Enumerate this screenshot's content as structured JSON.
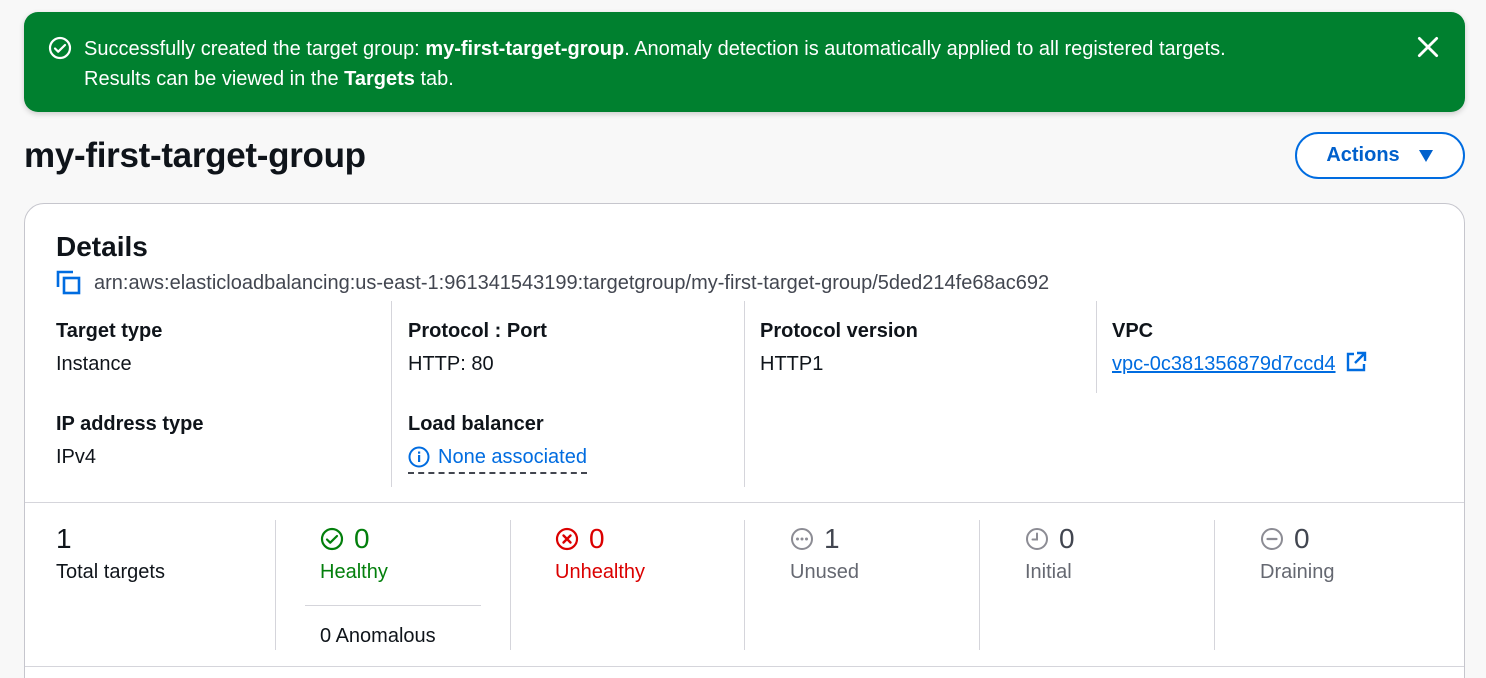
{
  "flash": {
    "line1_prefix": "Successfully created the target group: ",
    "line1_name": "my-first-target-group",
    "line1_suffix": ". Anomaly detection is automatically applied to all registered targets.",
    "line2_prefix": "Results can be viewed in the ",
    "line2_tab": "Targets",
    "line2_suffix": " tab.",
    "bg_color": "#00802f"
  },
  "header": {
    "title": "my-first-target-group",
    "actions_label": "Actions"
  },
  "details": {
    "title": "Details",
    "arn": "arn:aws:elasticloadbalancing:us-east-1:961341543199:targetgroup/my-first-target-group/5ded214fe68ac692",
    "target_type": {
      "label": "Target type",
      "value": "Instance"
    },
    "ip_address_type": {
      "label": "IP address type",
      "value": "IPv4"
    },
    "protocol_port": {
      "label": "Protocol : Port",
      "value": "HTTP: 80"
    },
    "load_balancer": {
      "label": "Load balancer",
      "value": "None associated"
    },
    "protocol_version": {
      "label": "Protocol version",
      "value": "HTTP1"
    },
    "vpc": {
      "label": "VPC",
      "value": "vpc-0c381356879d7ccd4"
    }
  },
  "stats": {
    "total": {
      "count": "1",
      "label": "Total targets"
    },
    "healthy": {
      "count": "0",
      "label": "Healthy",
      "color": "#037f0c",
      "icon": "check-circle-icon"
    },
    "anomalous": "0 Anomalous",
    "unhealthy": {
      "count": "0",
      "label": "Unhealthy",
      "color": "#db0000",
      "icon": "x-circle-icon"
    },
    "unused": {
      "count": "1",
      "label": "Unused",
      "color": "#656871",
      "icon": "ellipsis-circle-icon"
    },
    "initial": {
      "count": "0",
      "label": "Initial",
      "color": "#656871",
      "icon": "clock-circle-icon"
    },
    "draining": {
      "count": "0",
      "label": "Draining",
      "color": "#656871",
      "icon": "minus-circle-icon"
    }
  },
  "colors": {
    "link": "#006ce0",
    "accent": "#006ce0",
    "page_bg": "#f8f8f8"
  }
}
